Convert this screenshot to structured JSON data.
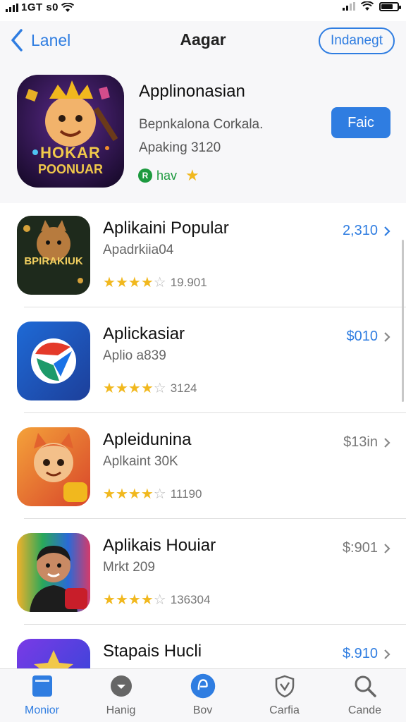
{
  "status": {
    "carrier": "1GT s0",
    "time": ""
  },
  "nav": {
    "back_label": "Lanel",
    "title": "Aagar",
    "pill_label": "Indanegt"
  },
  "featured": {
    "name": "Applinonasian",
    "subtitle": "Bepnkalona Corkala.",
    "meta": "Apaking 3120",
    "badge": "hav",
    "get_label": "Faic",
    "icon_text_1": "HOKAR",
    "icon_text_2": "POONUAR"
  },
  "apps": [
    {
      "name": "Aplikaini Popular",
      "sub": "Apadrkiia04",
      "rating": 4.5,
      "count": "19.901",
      "price": "2,310",
      "price_style": "blue",
      "icon_text": "BPIRAKIUK"
    },
    {
      "name": "Aplickasiar",
      "sub": "Aplio a839",
      "rating": 4.0,
      "count": "3124",
      "price": "$010",
      "price_style": "blue",
      "icon_text": ""
    },
    {
      "name": "Apleidunina",
      "sub": "Aplkaint 30K",
      "rating": 4.0,
      "count": "11190",
      "price": "$13in",
      "price_style": "grey",
      "icon_text": ""
    },
    {
      "name": "Aplikais Houiar",
      "sub": "Mrkt 209",
      "rating": 4.0,
      "count": "136304",
      "price": "$:901",
      "price_style": "grey",
      "icon_text": ""
    },
    {
      "name": "Stapais Hucli",
      "sub": "",
      "rating": 0,
      "count": "",
      "price": "$.910",
      "price_style": "blue",
      "icon_text": ""
    }
  ],
  "tabs": [
    {
      "label": "Monior",
      "icon": "app-store-icon",
      "active": true
    },
    {
      "label": "Hanig",
      "icon": "circle-badge-icon",
      "active": false
    },
    {
      "label": "Bov",
      "icon": "blue-circle-icon",
      "active": false
    },
    {
      "label": "Carfia",
      "icon": "shield-icon",
      "active": false
    },
    {
      "label": "Cande",
      "icon": "search-icon",
      "active": false
    }
  ],
  "colors": {
    "accent": "#2f7de1",
    "star": "#f1b81e",
    "badge_green": "#1d9a3f"
  }
}
